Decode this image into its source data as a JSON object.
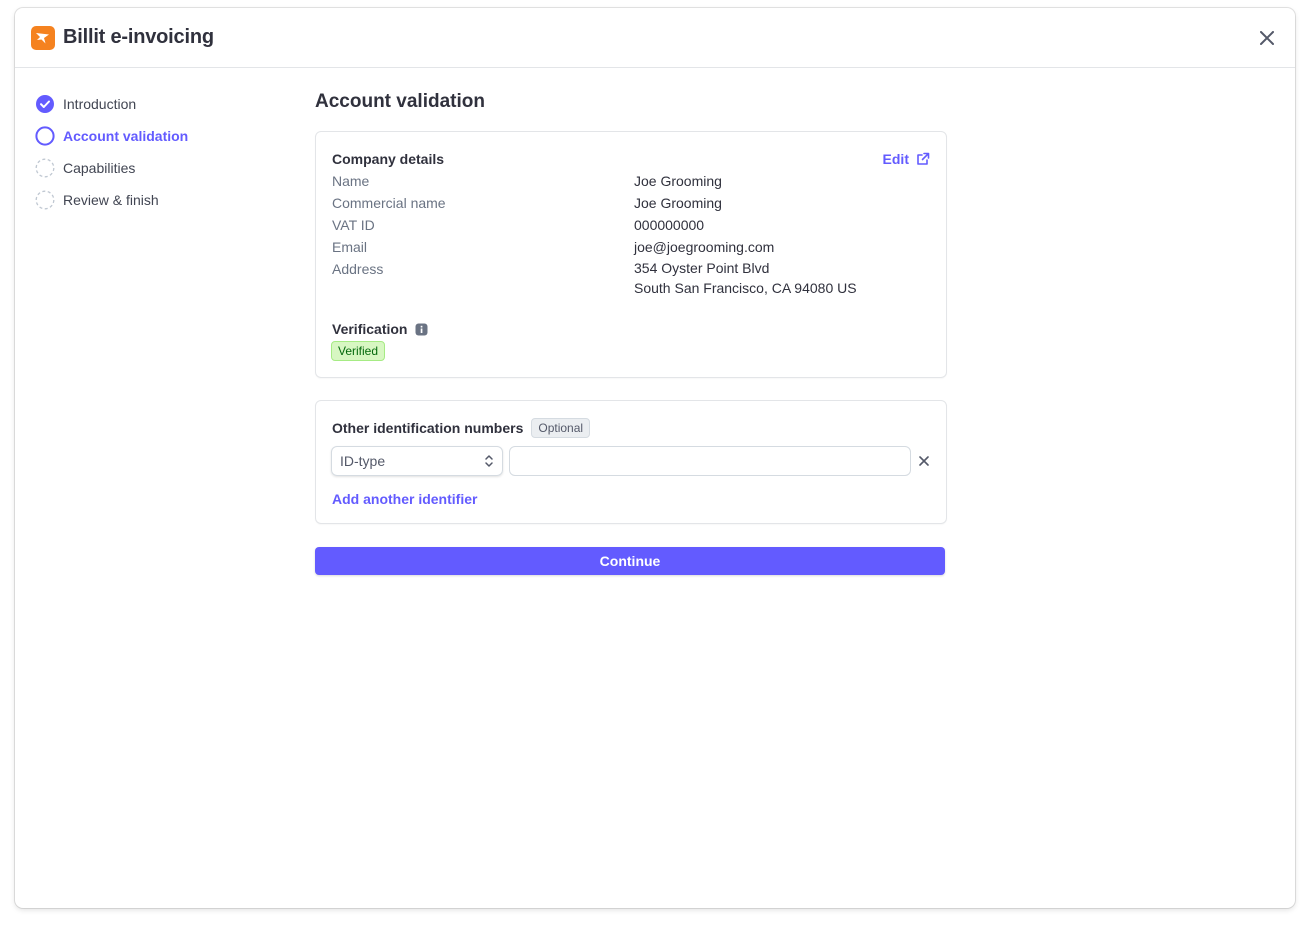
{
  "header": {
    "title": "Billit e-invoicing",
    "logo_icon": "billit-logo-icon",
    "close_icon": "close-icon"
  },
  "colors": {
    "accent": "#635bff",
    "logo": "#f5821f",
    "verified_bg": "#d7f7c2",
    "verified_text": "#05690d"
  },
  "sidebar": {
    "steps": [
      {
        "label": "Introduction",
        "state": "complete",
        "icon": "check-circle-icon"
      },
      {
        "label": "Account validation",
        "state": "current",
        "icon": "circle-outline-icon"
      },
      {
        "label": "Capabilities",
        "state": "pending",
        "icon": "dashed-circle-icon"
      },
      {
        "label": "Review & finish",
        "state": "pending",
        "icon": "dashed-circle-icon"
      }
    ]
  },
  "main": {
    "title": "Account validation",
    "company": {
      "heading": "Company details",
      "edit_label": "Edit",
      "fields": [
        {
          "label": "Name",
          "value": "Joe Grooming"
        },
        {
          "label": "Commercial name",
          "value": "Joe Grooming"
        },
        {
          "label": "VAT ID",
          "value": "000000000"
        },
        {
          "label": "Email",
          "value": "joe@joegrooming.com"
        }
      ],
      "address": {
        "label": "Address",
        "line1": "354 Oyster Point Blvd",
        "line2": "South San Francisco, CA 94080 US"
      },
      "verification": {
        "heading": "Verification",
        "status": "Verified"
      }
    },
    "identifiers": {
      "heading": "Other identification numbers",
      "optional_label": "Optional",
      "select_value": "ID-type",
      "input_value": "",
      "input_placeholder": "",
      "add_label": "Add another identifier"
    },
    "continue_label": "Continue"
  }
}
